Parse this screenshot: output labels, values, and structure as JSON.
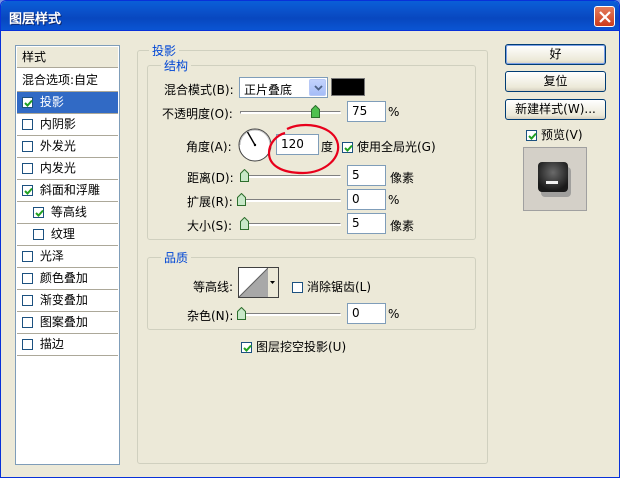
{
  "window": {
    "title": "图层样式"
  },
  "styles_list": {
    "header": "样式",
    "items": [
      {
        "label": "混合选项:自定",
        "checkbox": false,
        "checked": false
      },
      {
        "label": "投影",
        "checkbox": true,
        "checked": true,
        "selected": true
      },
      {
        "label": "内阴影",
        "checkbox": true,
        "checked": false
      },
      {
        "label": "外发光",
        "checkbox": true,
        "checked": false
      },
      {
        "label": "内发光",
        "checkbox": true,
        "checked": false
      },
      {
        "label": "斜面和浮雕",
        "checkbox": true,
        "checked": true
      },
      {
        "label": "等高线",
        "checkbox": true,
        "checked": true,
        "indent": true
      },
      {
        "label": "纹理",
        "checkbox": true,
        "checked": false,
        "indent": true
      },
      {
        "label": "光泽",
        "checkbox": true,
        "checked": false
      },
      {
        "label": "颜色叠加",
        "checkbox": true,
        "checked": false
      },
      {
        "label": "渐变叠加",
        "checkbox": true,
        "checked": false
      },
      {
        "label": "图案叠加",
        "checkbox": true,
        "checked": false
      },
      {
        "label": "描边",
        "checkbox": true,
        "checked": false
      }
    ]
  },
  "drop_shadow": {
    "section_title": "投影",
    "structure": {
      "group_title": "结构",
      "blend_mode_label": "混合模式(B):",
      "blend_mode_value": "正片叠底",
      "shadow_color": "#000000",
      "opacity_label": "不透明度(O):",
      "opacity_value": "75",
      "opacity_unit": "%",
      "opacity_fraction": 0.75,
      "angle_label": "角度(A):",
      "angle_value": "120",
      "angle_unit": "度",
      "global_light_label": "使用全局光(G)",
      "global_light_checked": true,
      "distance_label": "距离(D):",
      "distance_value": "5",
      "distance_unit": "像素",
      "spread_label": "扩展(R):",
      "spread_value": "0",
      "spread_unit": "%",
      "size_label": "大小(S):",
      "size_value": "5",
      "size_unit": "像素"
    },
    "quality": {
      "group_title": "品质",
      "contour_label": "等高线:",
      "anti_alias_label": "消除锯齿(L)",
      "anti_alias_checked": false,
      "noise_label": "杂色(N):",
      "noise_value": "0",
      "noise_unit": "%"
    },
    "knockout_label": "图层挖空投影(U)",
    "knockout_checked": true
  },
  "buttons": {
    "ok": "好",
    "reset": "复位",
    "new_style": "新建样式(W)...",
    "preview_label": "预览(V)",
    "preview_checked": true
  },
  "colors": {
    "selection": "#316ac5",
    "group_title": "#0046d5",
    "annotation": "#e8001c"
  }
}
